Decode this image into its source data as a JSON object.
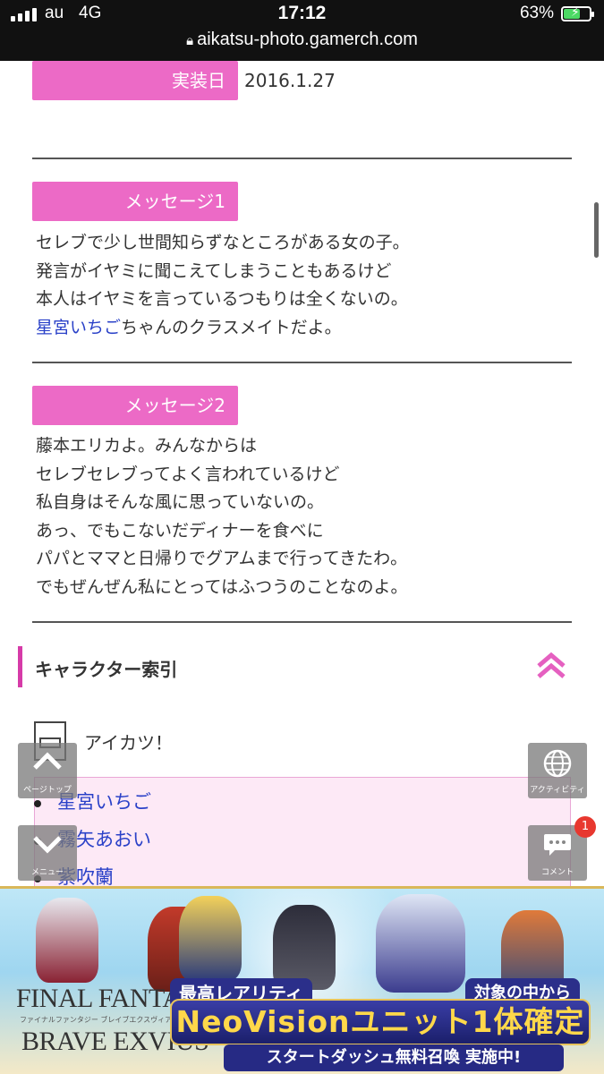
{
  "status_bar": {
    "carrier": "au",
    "network": "4G",
    "time": "17:12",
    "battery": "63%",
    "battery_level": 0.63,
    "url": "aikatsu-photo.gamerch.com"
  },
  "details": {
    "release_label": "実装日",
    "release_value": "2016.1.27"
  },
  "message1": {
    "label": "メッセージ1",
    "lines": [
      "セレブで少し世間知らずなところがある女の子。",
      "発言がイヤミに聞こえてしまうこともあるけど",
      "本人はイヤミを言っているつもりは全くないの。"
    ],
    "link_text": "星宮いちご",
    "link_suffix": "ちゃんのクラスメイトだよ。"
  },
  "message2": {
    "label": "メッセージ2",
    "lines": [
      "藤本エリカよ。みんなからは",
      "セレブセレブってよく言われているけど",
      "私自身はそんな風に思っていないの。",
      "あっ、でもこないだディナーを食べに",
      "パパとママと日帰りでグアムまで行ってきたわ。",
      "でもぜんぜん私にとってはふつうのことなのよ。"
    ]
  },
  "character_index": {
    "title": "キャラクター索引",
    "subcategory": "アイカツ！",
    "characters": [
      "星宮いちご",
      "霧矢あおい",
      "紫吹蘭"
    ]
  },
  "floating_buttons": {
    "page_top": "ページトップ",
    "menu": "メニュー",
    "activity": "アクティビティ",
    "comment": "コメント",
    "comment_badge": "1"
  },
  "ad": {
    "logo_line1": "FINAL FANTASY",
    "logo_jp": "ファイナルファンタジー ブレイブエクスヴィアス",
    "logo_line2": "BRAVE EXVIUS",
    "rarity": "最高レアリティ",
    "target": "対象の中から",
    "main": "NeoVisionユニット1体確定",
    "bottom": "スタートダッシュ無料召喚 実施中!"
  },
  "colors": {
    "label_bg": "#ec6ac6",
    "accent": "#d63ba8",
    "link": "#2a41c8"
  }
}
